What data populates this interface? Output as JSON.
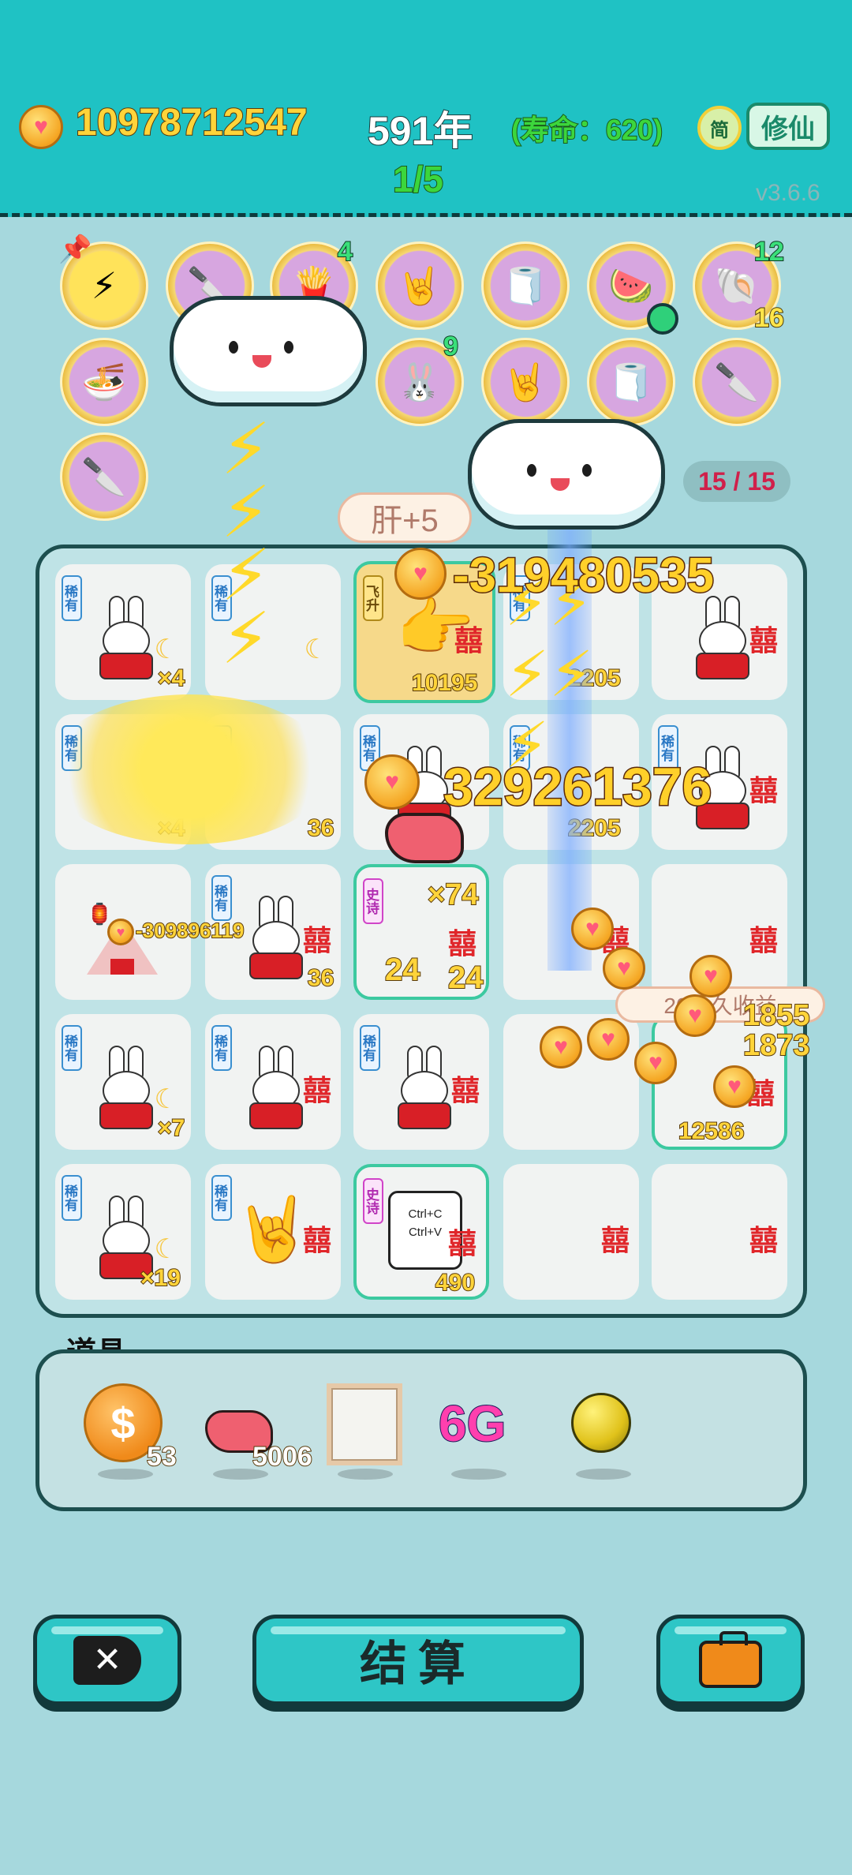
{
  "header": {
    "coins": "10978712547",
    "year": "591年",
    "lifespan": "(寿命：620)",
    "stage": "1/5",
    "simplified_label": "简",
    "mode_button": "修仙",
    "version": "v3.6.6"
  },
  "relics": [
    {
      "name": "lightning-relic",
      "glyph": "⚡"
    },
    {
      "name": "cleaver-relic",
      "glyph": "🔪"
    },
    {
      "name": "fries-relic",
      "glyph": "🍟",
      "count": "4"
    },
    {
      "name": "rock-hand-relic",
      "glyph": "🤘"
    },
    {
      "name": "tissue-relic",
      "glyph": "🧻"
    },
    {
      "name": "fruit-bowl-relic",
      "glyph": "🍉"
    },
    {
      "name": "shell-relic",
      "glyph": "🐚",
      "count_top": "12",
      "count_bottom": "16"
    },
    {
      "name": "noodle-bowl-relic",
      "glyph": "🍜"
    },
    {
      "name": "bunny-relic",
      "glyph": "🐰",
      "count": "9"
    },
    {
      "name": "rock-hand-relic-2",
      "glyph": "🤘"
    },
    {
      "name": "tissue-relic-2",
      "glyph": "🧻"
    },
    {
      "name": "cleaver-relic-2",
      "glyph": "🔪"
    },
    {
      "name": "cleaver-relic-3",
      "glyph": "🔪"
    }
  ],
  "relic_slots": "15 / 15",
  "board": {
    "liver_popup": "肝+5",
    "rarity_tag": "稀有",
    "ascend_tag": "飞升",
    "poem_tag": "史诗",
    "xi_glyph": "囍",
    "damage_1": "-319480535",
    "damage_2": "329261376",
    "small_damage": "-309896119",
    "permanent_gain": "20永久收益",
    "cells": {
      "r1c1": "×4",
      "r1c3": "10195",
      "r1c4": "2205",
      "r2c1": "×4",
      "r2c2": "36",
      "r2c4": "2205",
      "r3c2": "36",
      "r3c3_mult": "×74",
      "r3c3_a": "24",
      "r3c3_b": "24",
      "r4c1": "×7",
      "r4c5": "12586",
      "r4c5_a": "1855",
      "r4c5_b": "1873",
      "r5c1": "×19",
      "r5c3": "490",
      "ctrl_c": "Ctrl+C",
      "ctrl_v": "Ctrl+V"
    }
  },
  "props": {
    "title": "道具",
    "items": [
      {
        "name": "dollar-coin",
        "count": "53"
      },
      {
        "name": "liver",
        "count": "5006"
      },
      {
        "name": "frame",
        "count": ""
      },
      {
        "name": "6g",
        "label": "6G",
        "count": ""
      },
      {
        "name": "gold-orb",
        "count": ""
      }
    ]
  },
  "buttons": {
    "settle": "结算"
  },
  "colors": {
    "topbar": "#1fc2c4",
    "background": "#a6d8dd",
    "gold": "#ffd43a",
    "red_xi": "#e0262a"
  }
}
